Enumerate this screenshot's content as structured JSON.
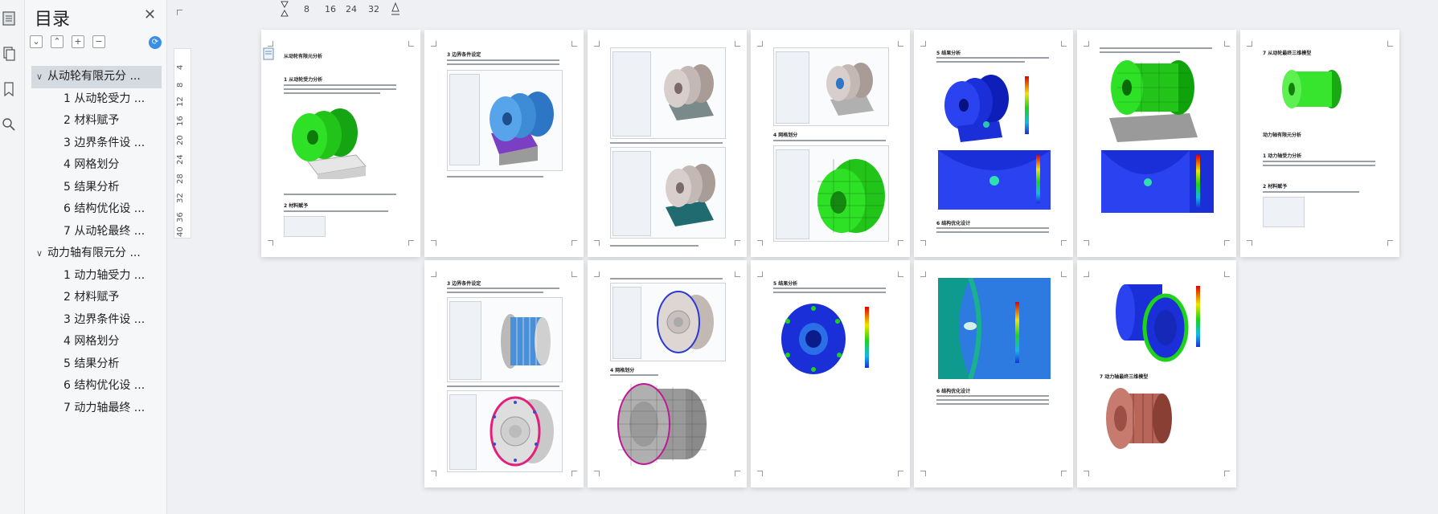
{
  "toc": {
    "title": "目录",
    "items": [
      {
        "label": "从动轮有限元分 ...",
        "level": 1,
        "expanded": true,
        "selected": true
      },
      {
        "label": "1 从动轮受力 ...",
        "level": 2
      },
      {
        "label": "2 材料赋予",
        "level": 2
      },
      {
        "label": "3 边界条件设 ...",
        "level": 2
      },
      {
        "label": "4 网格划分",
        "level": 2
      },
      {
        "label": "5 结果分析",
        "level": 2
      },
      {
        "label": "6 结构优化设 ...",
        "level": 2
      },
      {
        "label": "7 从动轮最终 ...",
        "level": 2
      },
      {
        "label": "动力轴有限元分 ...",
        "level": 1,
        "expanded": true
      },
      {
        "label": "1 动力轴受力 ...",
        "level": 2
      },
      {
        "label": "2 材料赋予",
        "level": 2
      },
      {
        "label": "3 边界条件设 ...",
        "level": 2
      },
      {
        "label": "4 网格划分",
        "level": 2
      },
      {
        "label": "5 结果分析",
        "level": 2
      },
      {
        "label": "6 结构优化设 ...",
        "level": 2
      },
      {
        "label": "7 动力轴最终 ...",
        "level": 2
      }
    ]
  },
  "ruler": {
    "horizontal": [
      "8",
      "16",
      "24",
      "32"
    ],
    "vertical": [
      "4",
      "8",
      "12",
      "16",
      "20",
      "24",
      "28",
      "32",
      "36",
      "40"
    ]
  },
  "pages": {
    "p1_heading": "从动轮有限元分析",
    "p1_sub1": "1 从动轮受力分析",
    "p1_sub2": "2 材料赋予",
    "p2_heading": "3 边界条件设定",
    "p4_heading": "4 网格划分",
    "p5_heading": "5 结果分析",
    "p5_sub": "6 结构优化设计",
    "p7_heading": "7 从动轮最终三维模型",
    "p7_sub1": "动力轴有限元分析",
    "p7_sub2": "1 动力轴受力分析",
    "p7_sub3": "2 材料赋予",
    "p8_heading": "3 边界条件设定",
    "p9_sub": "4 网格划分",
    "p10_heading": "5 结果分析",
    "p11_sub": "6 结构优化设计",
    "p12_sub": "7 动力轴最终三维模型"
  },
  "colors": {
    "accent": "#3a8ee6",
    "green": "#22c41a",
    "blue": "#1b2fd8",
    "steel_blue": "#3e8bd6"
  }
}
